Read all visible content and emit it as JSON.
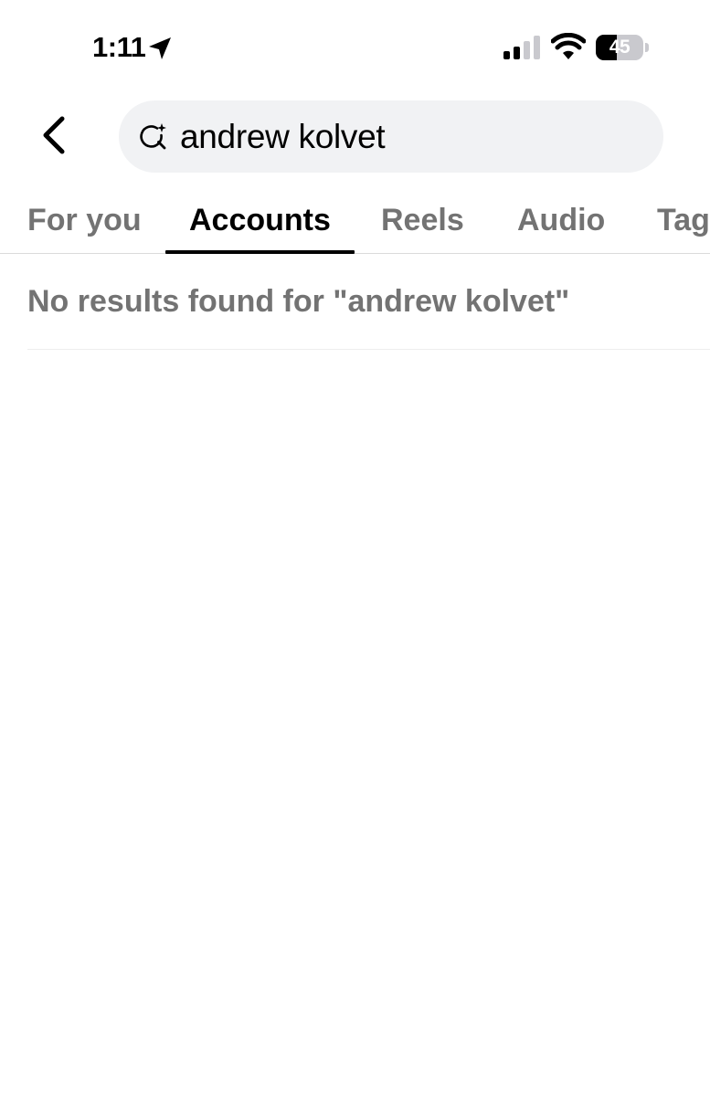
{
  "status_bar": {
    "time": "1:11",
    "battery_level": "45",
    "battery_fraction": 0.45,
    "signal_bars_active": 2,
    "signal_bars_total": 4
  },
  "header": {
    "back_icon": "chevron-left-icon",
    "search": {
      "icon": "search-sparkle-icon",
      "value": "andrew kolvet"
    }
  },
  "tabs": [
    {
      "label": "For you",
      "active": false
    },
    {
      "label": "Accounts",
      "active": true
    },
    {
      "label": "Reels",
      "active": false
    },
    {
      "label": "Audio",
      "active": false
    },
    {
      "label": "Tags",
      "active": false
    }
  ],
  "results": {
    "empty_message": "No results found for \"andrew kolvet\""
  },
  "colors": {
    "active_text": "#000000",
    "inactive_text": "#737373",
    "search_background": "#f1f2f4"
  }
}
